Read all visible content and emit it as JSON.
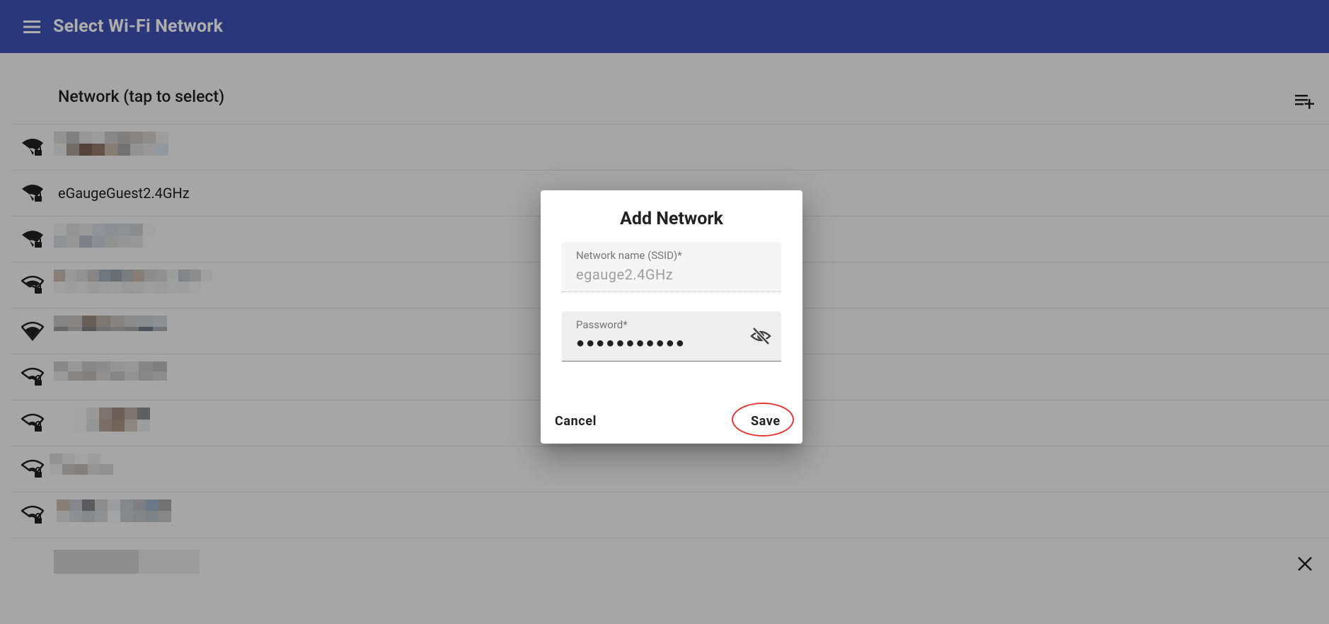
{
  "appbar": {
    "title": "Select Wi-Fi Network",
    "menu_icon": "menu-icon"
  },
  "list": {
    "header_label": "Network (tap to select)",
    "add_icon": "playlist-add-icon",
    "networks": [
      {
        "name": "",
        "secured": true,
        "signal": "strong"
      },
      {
        "name": "eGaugeGuest2.4GHz",
        "secured": true,
        "signal": "strong"
      },
      {
        "name": "",
        "secured": true,
        "signal": "strong"
      },
      {
        "name": "",
        "secured": true,
        "signal": "medium"
      },
      {
        "name": "",
        "secured": false,
        "signal": "medium"
      },
      {
        "name": "",
        "secured": true,
        "signal": "weak"
      },
      {
        "name": "",
        "secured": true,
        "signal": "weak"
      },
      {
        "name": "",
        "secured": true,
        "signal": "weak"
      },
      {
        "name": "",
        "secured": true,
        "signal": "weak"
      }
    ],
    "close_icon": "close-icon"
  },
  "dialog": {
    "title": "Add Network",
    "ssid_label": "Network name (SSID)*",
    "ssid_value": "egauge2.4GHz",
    "password_label": "Password*",
    "password_value": "●●●●●●●●●●●",
    "visibility_icon": "eye-off-icon",
    "cancel_label": "Cancel",
    "save_label": "Save"
  },
  "colors": {
    "appbar": "#3f51b5",
    "highlight": "#e53935"
  }
}
